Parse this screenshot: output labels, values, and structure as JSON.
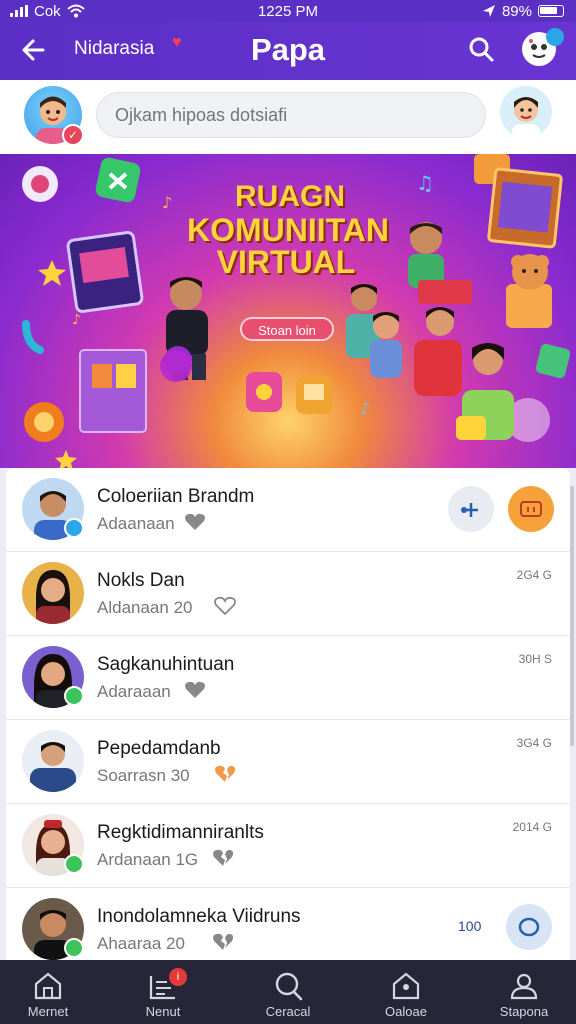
{
  "status_bar": {
    "carrier": "Cok",
    "time": "1225 PM",
    "battery": "89%"
  },
  "app_bar": {
    "subtitle": "Nidarasia",
    "title": "Papa",
    "accent": "#5b2fc6"
  },
  "composer": {
    "placeholder": "Ojkam hipoas dotsiafi"
  },
  "banner": {
    "title_lines": [
      "RUAGN",
      "KOMUNIITAN",
      "VIRTUAL"
    ],
    "button": "Stoan loin"
  },
  "list": [
    {
      "name": "Coloeriian Brandm",
      "sub": "Adaanaan",
      "time": "",
      "status": "verified",
      "heart": "heart-icon"
    },
    {
      "name": "Nokls Dan",
      "sub": "Aldanaan 20",
      "time": "2G4 G",
      "status": "",
      "heart": "heart-outline-icon"
    },
    {
      "name": "Sagkanuhintuan",
      "sub": "Adaraaan",
      "time": "30H S",
      "status": "online",
      "heart": "heart-icon"
    },
    {
      "name": "Pepedamdanb",
      "sub": "Soarrasn 30",
      "time": "3G4 G",
      "status": "",
      "heart": "broken-heart-icon"
    },
    {
      "name": "Regktidimanniranlts",
      "sub": "Ardanaan 1G",
      "time": "2014 G",
      "status": "online",
      "heart": "broken-heart-icon"
    },
    {
      "name": "Inondolamneka Viidruns",
      "sub": "Ahaaraa 20",
      "time": "",
      "status": "online",
      "heart": "broken-heart-icon",
      "count": "100"
    }
  ],
  "bottom_nav": [
    {
      "label": "Mernet",
      "icon": "home-icon"
    },
    {
      "label": "Nenut",
      "icon": "feed-icon",
      "badge": "i"
    },
    {
      "label": "Ceracal",
      "icon": "search-icon"
    },
    {
      "label": "Oaloae",
      "icon": "community-icon"
    },
    {
      "label": "Stapona",
      "icon": "profile-icon"
    }
  ]
}
